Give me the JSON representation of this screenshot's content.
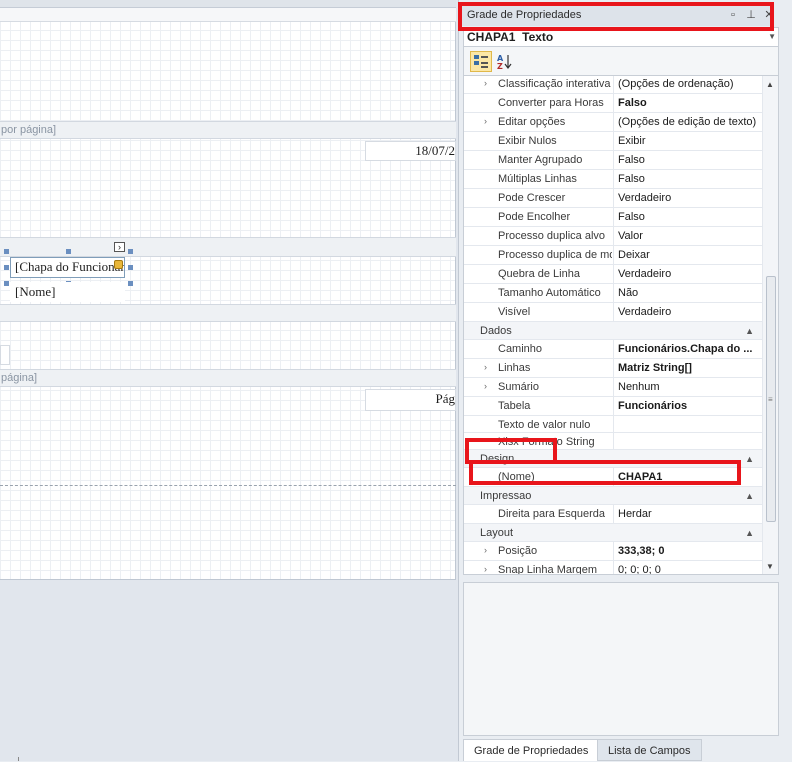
{
  "designer": {
    "band_page_header": "por página]",
    "date_field": "18/07/2",
    "label_chapa": "[Chapa do Funcionar",
    "label_nome": "[Nome]",
    "band_page_footer": "página]",
    "page_field": "Pág"
  },
  "panel": {
    "title": "Grade de Propriedades",
    "pin_icon": "pin-icon",
    "float_icon": "float-window-icon",
    "close_icon": "close-icon",
    "object_name": "CHAPA1",
    "object_type": "Texto",
    "toolbar": {
      "categorized_icon": "categorized-view-icon",
      "alphabetical_icon": "sort-alphabetical-icon",
      "alphabetical_glyph": "A↓Z"
    },
    "rows_top": [
      {
        "name": "Classificação interativa",
        "value": "(Opções de ordenação)",
        "expandable": true,
        "bold": false
      },
      {
        "name": "Converter para Horas",
        "value": "Falso",
        "expandable": false,
        "bold": true
      },
      {
        "name": "Editar opções",
        "value": "(Opções de edição de texto)",
        "expandable": true,
        "bold": false
      },
      {
        "name": "Exibir Nulos",
        "value": "Exibir",
        "expandable": false,
        "bold": false
      },
      {
        "name": "Manter Agrupado",
        "value": "Falso",
        "expandable": false,
        "bold": false
      },
      {
        "name": "Múltiplas Linhas",
        "value": "Falso",
        "expandable": false,
        "bold": false
      },
      {
        "name": "Pode Crescer",
        "value": "Verdadeiro",
        "expandable": false,
        "bold": false
      },
      {
        "name": "Pode Encolher",
        "value": "Falso",
        "expandable": false,
        "bold": false
      },
      {
        "name": "Processo duplica alvo",
        "value": "Valor",
        "expandable": false,
        "bold": false
      },
      {
        "name": "Processo duplica de mod",
        "value": "Deixar",
        "expandable": false,
        "bold": false
      },
      {
        "name": "Quebra de Linha",
        "value": "Verdadeiro",
        "expandable": false,
        "bold": false
      },
      {
        "name": "Tamanho Automático",
        "value": "Não",
        "expandable": false,
        "bold": false
      },
      {
        "name": "Visível",
        "value": "Verdadeiro",
        "expandable": false,
        "bold": false
      }
    ],
    "cat_dados": "Dados",
    "rows_dados": [
      {
        "name": "Caminho",
        "value": "Funcionários.Chapa do ...",
        "expandable": false,
        "bold": true
      },
      {
        "name": "Linhas",
        "value": "Matriz String[]",
        "expandable": true,
        "bold": true
      },
      {
        "name": "Sumário",
        "value": "Nenhum",
        "expandable": true,
        "bold": false
      },
      {
        "name": "Tabela",
        "value": "Funcionários",
        "expandable": false,
        "bold": true
      },
      {
        "name": "Texto de valor nulo",
        "value": "",
        "expandable": false,
        "bold": false
      },
      {
        "name": "Xlsx Formato String",
        "value": "",
        "expandable": false,
        "bold": false
      }
    ],
    "cat_design": "Design",
    "row_nome": {
      "name": "(Nome)",
      "value": "CHAPA1"
    },
    "cat_impressao": "Impressao",
    "row_direita": {
      "name": "Direita para Esquerda",
      "value": "Herdar"
    },
    "cat_layout": "Layout",
    "rows_layout": [
      {
        "name": "Posição",
        "value": "333,38; 0",
        "expandable": true,
        "bold": true
      },
      {
        "name": "Snap Linha Margem",
        "value": "0; 0; 0; 0",
        "expandable": true,
        "bold": false
      }
    ],
    "tabs": [
      "Grade de Propriedades",
      "Lista de Campos"
    ]
  },
  "colors": {
    "annotation": "#e8151b",
    "selected_button": "#fbe7a6"
  }
}
